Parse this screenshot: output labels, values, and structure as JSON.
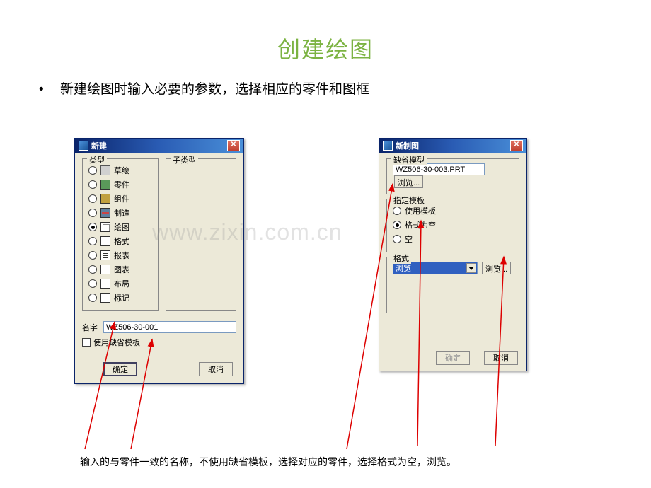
{
  "slide": {
    "title": "创建绘图",
    "bullet": "新建绘图时输入必要的参数，选择相应的零件和图框",
    "caption": "输入的与零件一致的名称，不使用缺省模板，选择对应的零件，选择格式为空，浏览。"
  },
  "watermark": "www.zixin.com.cn",
  "dialog1": {
    "title": "新建",
    "group_type": "类型",
    "group_subtype": "子类型",
    "types": {
      "sketch": "草绘",
      "part": "零件",
      "assembly": "组件",
      "mfg": "制造",
      "drawing": "绘图",
      "format": "格式",
      "report": "报表",
      "diagram": "图表",
      "layout": "布局",
      "markup": "标记"
    },
    "name_label": "名字",
    "name_value": "WZ506-30-001",
    "use_default_template": "使用缺省模板",
    "ok": "确定",
    "cancel": "取消"
  },
  "dialog2": {
    "title": "新制图",
    "group_default_model": "缺省模型",
    "model_value": "WZ506-30-003.PRT",
    "browse": "浏览...",
    "group_template": "指定模板",
    "opt_use_template": "使用模板",
    "opt_format_empty": "格式为空",
    "opt_empty": "空",
    "group_format": "格式",
    "format_value": "浏览",
    "ok": "确定",
    "cancel": "取消"
  }
}
